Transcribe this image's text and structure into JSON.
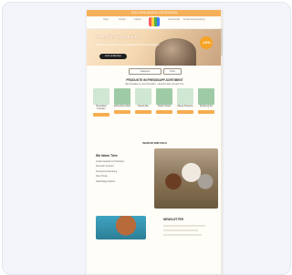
{
  "topbar_text": "BELOHNUNGEN VERDIENEN",
  "nav": {
    "items": [
      "Shop",
      "Hunde",
      "Katzen",
      "Geschenke",
      "Ernährungsberatung"
    ]
  },
  "hero": {
    "title": "Fressnapf Hydrationen",
    "subtitle": "Spielzeug, Zubehör und ausgewählte Gourmetangebote",
    "button": "Jetzt entdecken",
    "badge": "-10%"
  },
  "filters": {
    "items": [
      "Kategorie",
      "Preis"
    ]
  },
  "section": {
    "title": "PRODUKTE IM FRESSNAPF-SORTIMENT",
    "text": "Alle Produkte in einer Übersicht – ideal für dich und dein Tier."
  },
  "products": [
    {
      "name": "Hundefutter Premium",
      "color": "#cfe7d3"
    },
    {
      "name": "Katzenstreu Natur",
      "color": "#9ecba5"
    },
    {
      "name": "Snacks Mix",
      "color": "#cfe7d3"
    },
    {
      "name": "Vitamin Drops",
      "color": "#9ecba5"
    },
    {
      "name": "Pflege Shampoo",
      "color": "#cfe7d3"
    },
    {
      "name": "Spielzeug Set",
      "color": "#9ecba5"
    }
  ],
  "feature": {
    "heading": "WARUM WIR DICH",
    "title": "Wir lieben Tiere",
    "rows": [
      "Große Auswahl an Produkten",
      "Schneller Versand",
      "Kompetente Beratung",
      "Faire Preise",
      "Nachhaltige Marken"
    ]
  },
  "newsletter": {
    "title": "NEWSLETTER"
  }
}
